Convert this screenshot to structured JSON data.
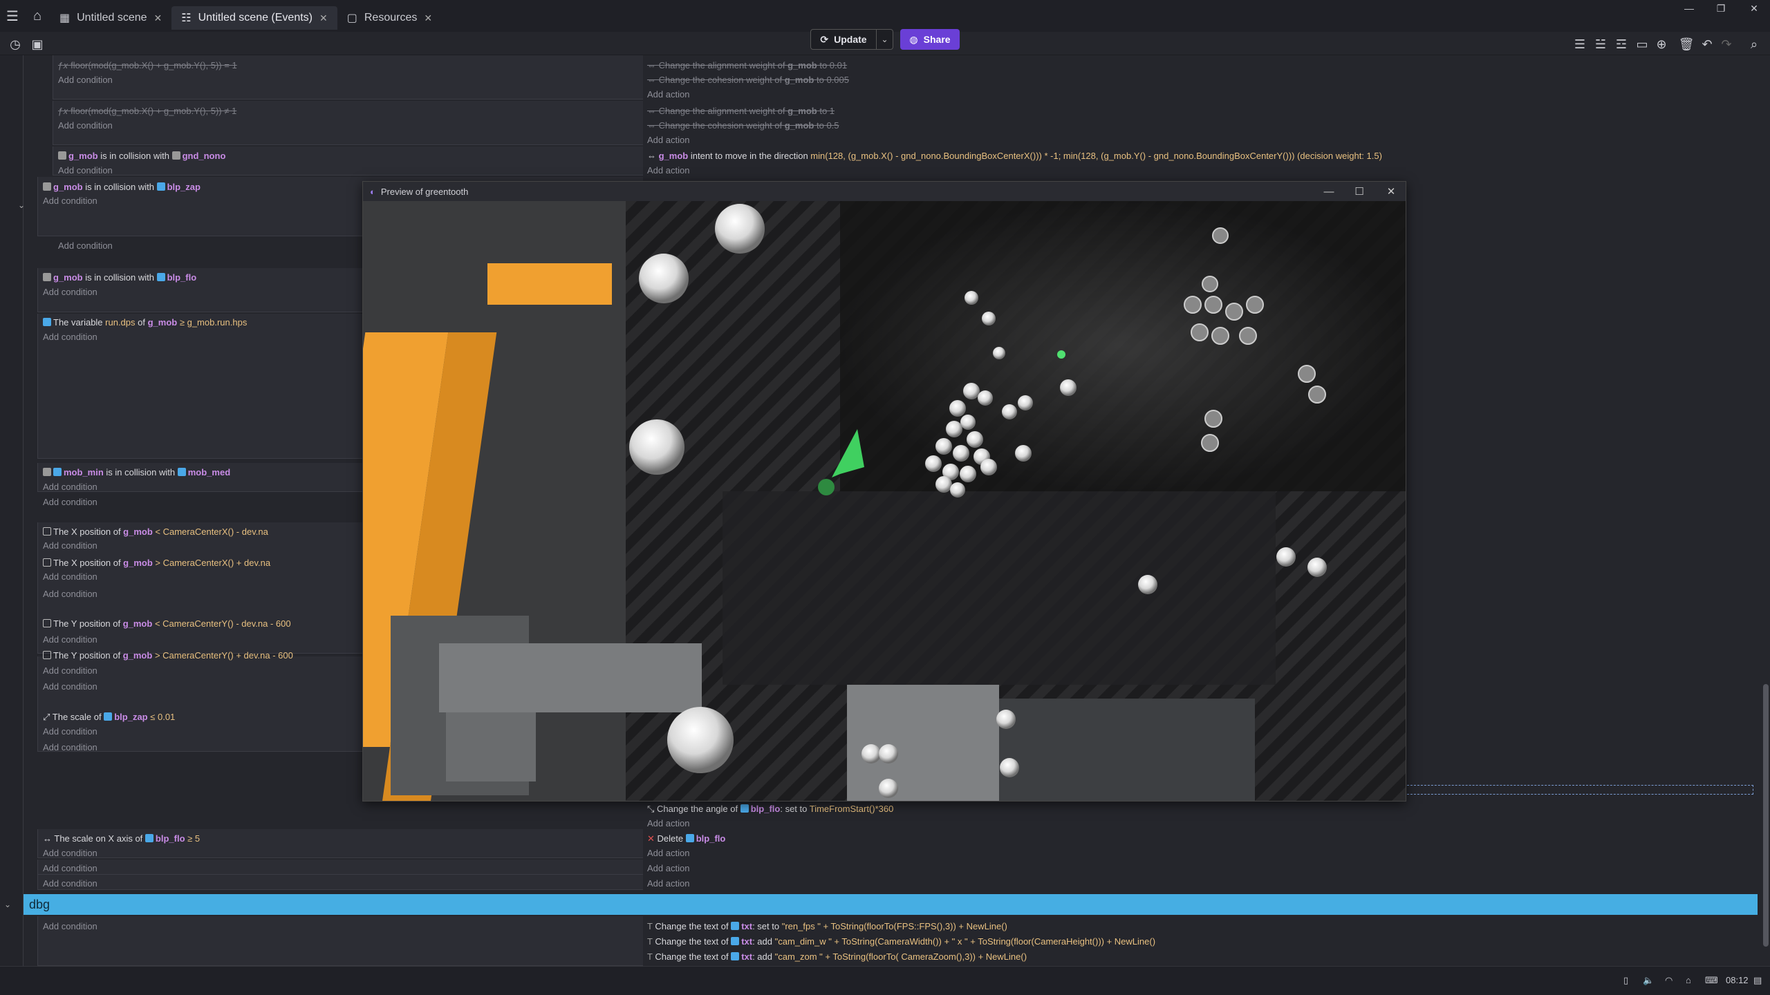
{
  "tabs": [
    {
      "label": "Untitled scene",
      "icon": "scene-icon"
    },
    {
      "label": "Untitled scene (Events)",
      "icon": "events-icon"
    },
    {
      "label": "Resources",
      "icon": "resources-icon"
    }
  ],
  "toolbar": {
    "update_label": "Update",
    "share_label": "Share"
  },
  "events": {
    "r1c": "floor(mod(g_mob.X() + g_mob.Y(), 5)) = 1",
    "r1a1": "Change the alignment weight of ",
    "r1a1o": "g_mob",
    "r1a1v": " to 0.01",
    "r1a2": "Change the cohesion weight of ",
    "r1a2o": "g_mob",
    "r1a2v": " to 0.005",
    "r2c": "floor(mod(g_mob.X() + g_mob.Y(), 5)) ≠ 1",
    "r2a1": "Change the alignment weight of ",
    "r2a1o": "g_mob",
    "r2a1v": " to 1",
    "r2a2": "Change the cohesion weight of ",
    "r2a2o": "g_mob",
    "r2a2v": " to 0.5",
    "r3o1": "g_mob",
    "r3t": " is in collision with ",
    "r3o2": "gnd_nono",
    "r3ao": "g_mob",
    "r3at": " intent to move in the direction ",
    "r3ae": "min(128, (g_mob.X() - gnd_nono.BoundingBoxCenterX())) * -1; min(128, (g_mob.Y() - gnd_nono.BoundingBoxCenterY())) (decision weight: 1.5)",
    "r4o1": "g_mob",
    "r4t": " is in collision with ",
    "r4o2": "blp_zap",
    "r5o1": "g_mob",
    "r5t": " is in collision with ",
    "r5o2": "blp_flo",
    "r6t1": "The variable ",
    "r6v": "run.dps",
    "r6t2": " of ",
    "r6o": "g_mob",
    "r6e": " ≥ g_mob.run.hps",
    "r7o1": "mob_min",
    "r7t": " is in collision with ",
    "r7o2": "mob_med",
    "r8t": "The X position of ",
    "r8o": "g_mob",
    "r8e": " < CameraCenterX() - dev.na",
    "r9t": "The X position of ",
    "r9o": "g_mob",
    "r9e": " > CameraCenterX() + dev.na",
    "r10t": "The Y position of ",
    "r10o": "g_mob",
    "r10e": " < CameraCenterY() - dev.na - 600",
    "r11t": "The Y position of ",
    "r11o": "g_mob",
    "r11e": " > CameraCenterY() + dev.na - 600",
    "r12t": "The scale of ",
    "r12o": "blp_zap",
    "r12e": " ≤ 0.01",
    "r13at": "Change the angle of ",
    "r13ao": "blp_flo",
    "r13ae1": ": set to ",
    "r13ae2": "TimeFromStart()*360",
    "r14t": "The scale on X axis of ",
    "r14o": "blp_flo",
    "r14e": " ≥ 5",
    "r14at": "Delete ",
    "r14ao": "blp_flo",
    "dbg1t": "Change the text of ",
    "dbg1o": "txt",
    "dbg1e1": ": set to ",
    "dbg1e2": "\"ren_fps \" + ToString(floorTo(FPS::FPS(),3)) + NewLine()",
    "dbg2t": "Change the text of ",
    "dbg2o": "txt",
    "dbg2e1": ": add ",
    "dbg2e2": "\"cam_dim_w \" + ToString(CameraWidth()) + \" x \" + ToString(floor(CameraHeight())) + NewLine()",
    "dbg3t": "Change the text of ",
    "dbg3o": "txt",
    "dbg3e1": ": add ",
    "dbg3e2": "\"cam_zom \" + ToString(floorTo( CameraZoom(),3)) + NewLine()",
    "add_condition": "Add condition",
    "add_action": "Add action"
  },
  "group": {
    "name": "dbg"
  },
  "preview": {
    "title": "Preview of greentooth"
  },
  "statusbar": {
    "time": "08:12"
  }
}
